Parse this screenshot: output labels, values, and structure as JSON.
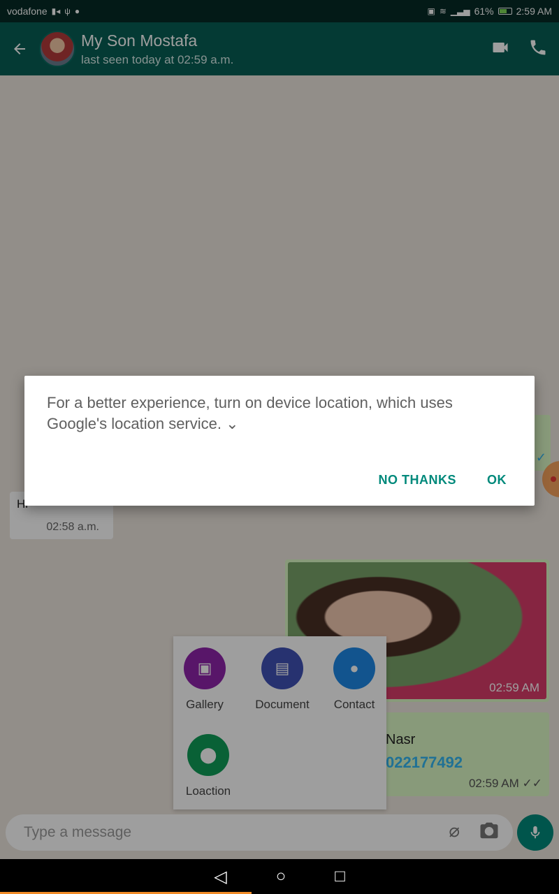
{
  "status_bar": {
    "carrier": "vodafone",
    "battery": "61%",
    "time": "2:59 AM"
  },
  "header": {
    "contact_name": "My Son Mostafa",
    "last_seen": "last seen today at 02:59 a.m."
  },
  "messages": {
    "incoming_text": "Hi",
    "incoming_time": "02:58 a.m.",
    "image_time": "02:59 AM",
    "contact_card_name": "Nasr",
    "contact_card_phone": "022177492",
    "contact_card_time": "02:59 AM"
  },
  "attach_menu": {
    "items": [
      {
        "label": "Gallery",
        "color": "#8e24aa"
      },
      {
        "label": "Document",
        "color": "#3f51b5"
      },
      {
        "label": "Contact",
        "color": "#1e88e5"
      },
      {
        "label": "Loaction",
        "color": "#0f9d58"
      }
    ]
  },
  "input": {
    "placeholder": "Type a message"
  },
  "dialog": {
    "message": "For a better experience, turn on device location, which uses Google's location service.",
    "no_thanks": "NO THANKS",
    "ok": "OK"
  },
  "colors": {
    "appbar": "#075e54",
    "accent": "#00897b"
  }
}
